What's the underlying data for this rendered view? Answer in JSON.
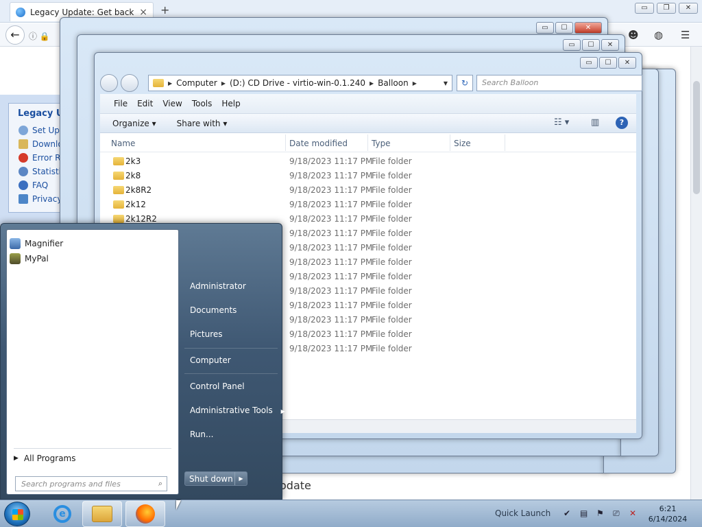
{
  "firefox": {
    "tab_title": "Legacy Update: Get back o...",
    "new_tab": "+",
    "close_tab": "×",
    "caption": {
      "minimize": "▭",
      "restore": "❐",
      "close": "✕"
    },
    "back": "←",
    "url_icons": "ⓘ 🔒",
    "legacy_box": {
      "title": "Legacy Up",
      "items": [
        "Set Up",
        "Downlo",
        "Error R",
        "Statisti",
        "FAQ",
        "Privacy"
      ]
    },
    "page_text": "odate"
  },
  "explorer": {
    "caption": {
      "minimize": "▭",
      "maximize": "☐",
      "close": "✕"
    },
    "address": {
      "crumbs": [
        "Computer",
        "(D:) CD Drive - virtio-win-0.1.240",
        "Balloon"
      ]
    },
    "refresh": "↻",
    "search_placeholder": "Search Balloon",
    "menu": [
      "File",
      "Edit",
      "View",
      "Tools",
      "Help"
    ],
    "commands": {
      "organize": "Organize ▾",
      "share": "Share with ▾",
      "help": "?"
    },
    "columns": {
      "name": "Name",
      "date": "Date modified",
      "type": "Type",
      "size": "Size"
    },
    "rows": [
      {
        "name": "2k3",
        "date": "9/18/2023 11:17 PM",
        "type": "File folder"
      },
      {
        "name": "2k8",
        "date": "9/18/2023 11:17 PM",
        "type": "File folder"
      },
      {
        "name": "2k8R2",
        "date": "9/18/2023 11:17 PM",
        "type": "File folder"
      },
      {
        "name": "2k12",
        "date": "9/18/2023 11:17 PM",
        "type": "File folder"
      },
      {
        "name": "2k12R2",
        "date": "9/18/2023 11:17 PM",
        "type": "File folder"
      },
      {
        "name": "",
        "date": "9/18/2023 11:17 PM",
        "type": "File folder"
      },
      {
        "name": "",
        "date": "9/18/2023 11:17 PM",
        "type": "File folder"
      },
      {
        "name": "",
        "date": "9/18/2023 11:17 PM",
        "type": "File folder"
      },
      {
        "name": "",
        "date": "9/18/2023 11:17 PM",
        "type": "File folder"
      },
      {
        "name": "",
        "date": "9/18/2023 11:17 PM",
        "type": "File folder"
      },
      {
        "name": "",
        "date": "9/18/2023 11:17 PM",
        "type": "File folder"
      },
      {
        "name": "",
        "date": "9/18/2023 11:17 PM",
        "type": "File folder"
      },
      {
        "name": "",
        "date": "9/18/2023 11:17 PM",
        "type": "File folder"
      },
      {
        "name": "",
        "date": "9/18/2023 11:17 PM",
        "type": "File folder"
      }
    ]
  },
  "start_menu": {
    "programs": [
      "Magnifier",
      "MyPal"
    ],
    "all_programs": "All Programs",
    "search_placeholder": "Search programs and files",
    "right": [
      "Administrator",
      "Documents",
      "Pictures",
      "Computer",
      "Control Panel",
      "Administrative Tools",
      "Run..."
    ],
    "shutdown": "Shut down"
  },
  "taskbar": {
    "quick_launch": "Quick Launch",
    "time": "6:21",
    "date": "6/14/2024"
  }
}
